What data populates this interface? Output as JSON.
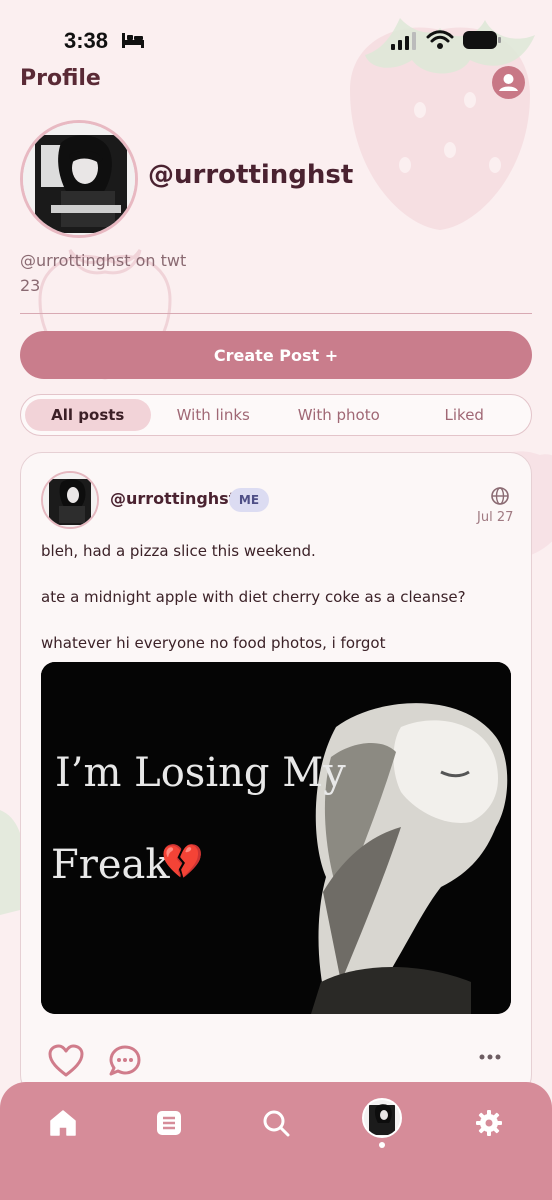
{
  "status_bar": {
    "time": "3:38"
  },
  "header": {
    "title": "Profile"
  },
  "profile": {
    "handle": "@urrottinghst",
    "bio": "@urrottinghst on twt",
    "count": "23"
  },
  "actions": {
    "create_post_label": "Create Post +"
  },
  "filters": {
    "tabs": [
      "All posts",
      "With links",
      "With photo",
      "Liked"
    ],
    "selected": "All posts"
  },
  "post": {
    "handle": "@urrottinghst",
    "badge": "ME",
    "date": "Jul 27",
    "lines": [
      "bleh, had a pizza slice this weekend.",
      "ate a midnight apple with diet cherry coke as a cleanse?",
      "whatever hi everyone no food photos, i forgot"
    ],
    "image_caption_line_1": "I’m Losing My",
    "image_caption_line_2": "Freak",
    "image_emoji": "💔"
  },
  "icons": [
    "bed-icon",
    "signal-icon",
    "wifi-icon",
    "battery-icon",
    "account-icon",
    "globe-icon",
    "heart-icon",
    "comment-icon",
    "more-icon",
    "home-icon",
    "list-icon",
    "search-icon",
    "settings-icon"
  ],
  "colors": {
    "background": "#fbeff0",
    "accent": "#c97d8c",
    "tab_bar": "#d68c99",
    "badge": "#dcdcf2"
  }
}
